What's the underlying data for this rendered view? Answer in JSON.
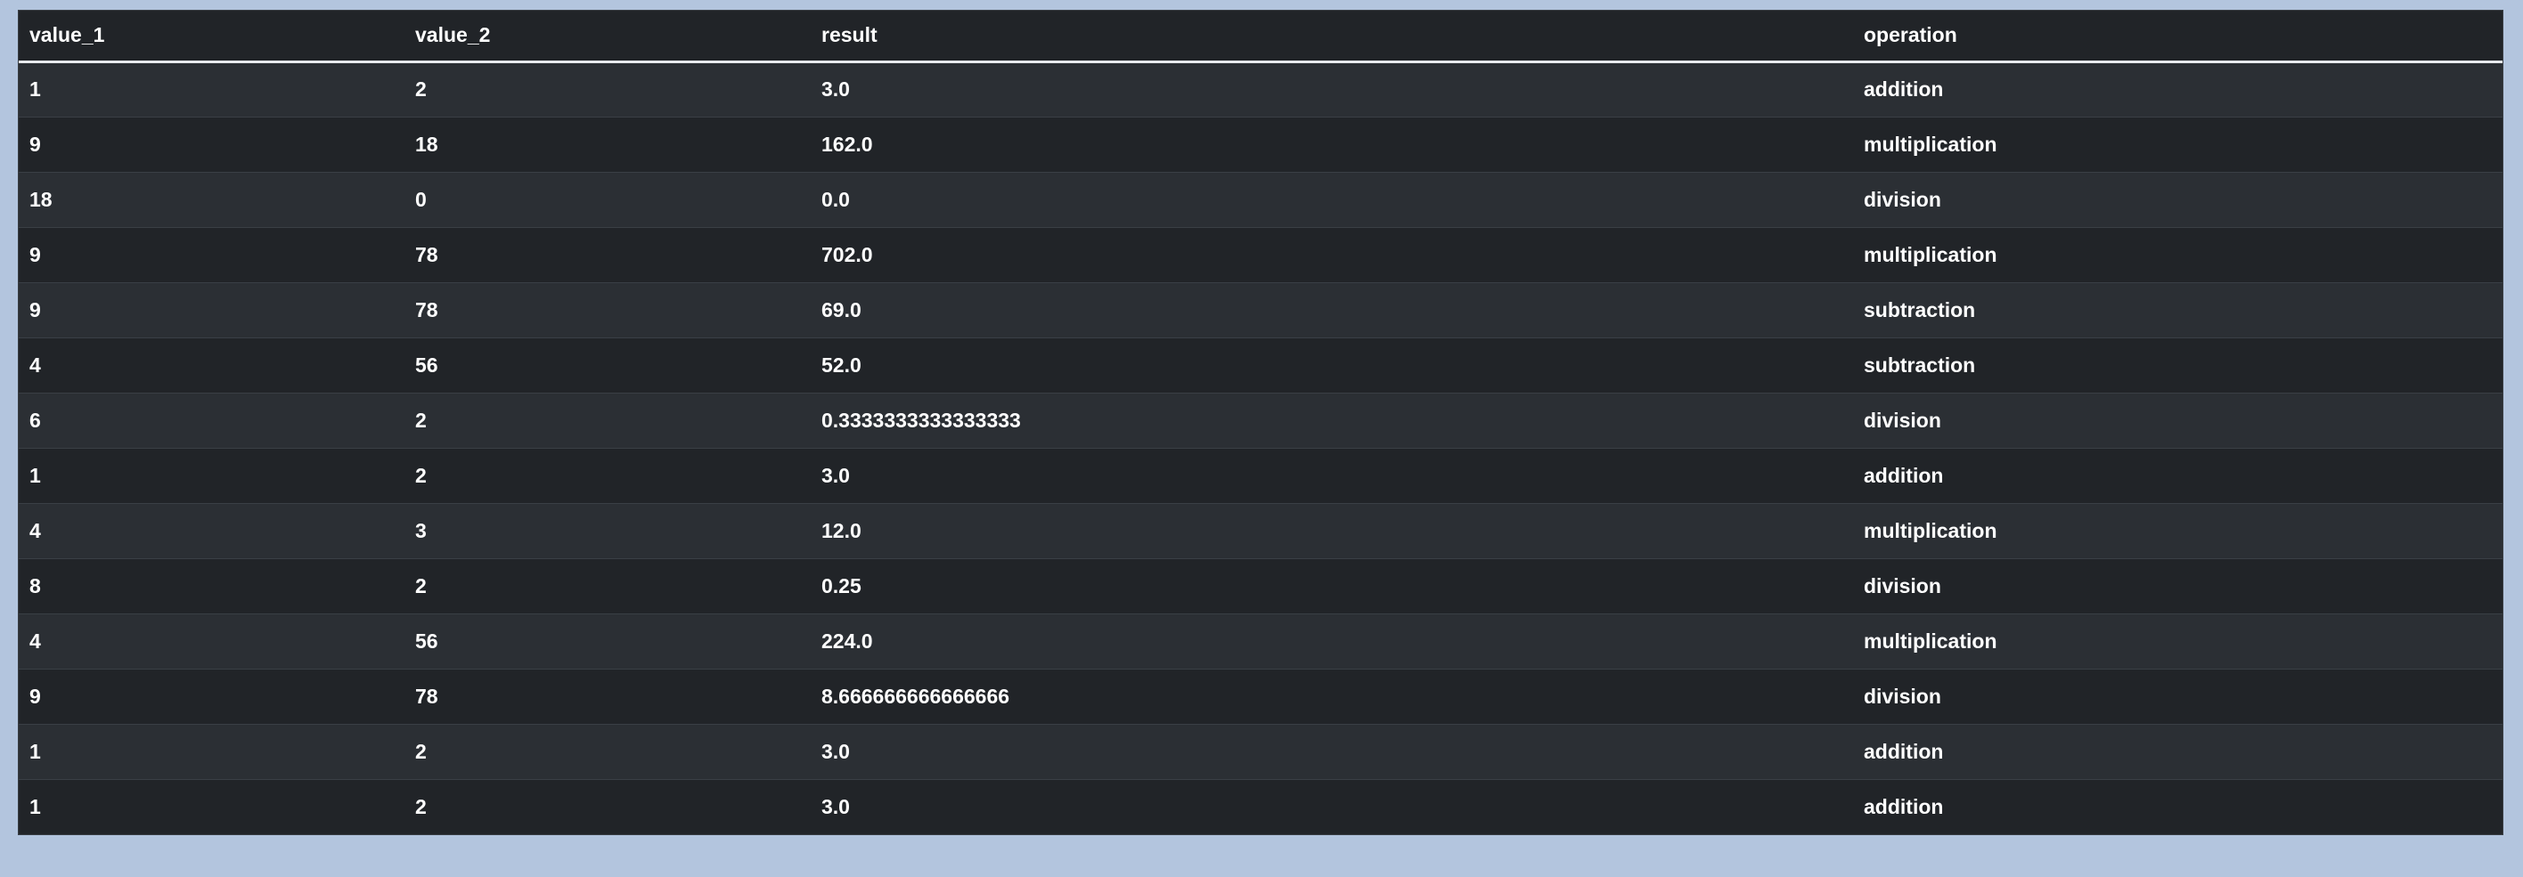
{
  "table": {
    "columns": [
      "value_1",
      "value_2",
      "result",
      "operation"
    ],
    "rows": [
      [
        "1",
        "2",
        "3.0",
        "addition"
      ],
      [
        "9",
        "18",
        "162.0",
        "multiplication"
      ],
      [
        "18",
        "0",
        "0.0",
        "division"
      ],
      [
        "9",
        "78",
        "702.0",
        "multiplication"
      ],
      [
        "9",
        "78",
        "69.0",
        "subtraction"
      ],
      [
        "4",
        "56",
        "52.0",
        "subtraction"
      ],
      [
        "6",
        "2",
        "0.3333333333333333",
        "division"
      ],
      [
        "1",
        "2",
        "3.0",
        "addition"
      ],
      [
        "4",
        "3",
        "12.0",
        "multiplication"
      ],
      [
        "8",
        "2",
        "0.25",
        "division"
      ],
      [
        "4",
        "56",
        "224.0",
        "multiplication"
      ],
      [
        "9",
        "78",
        "8.666666666666666",
        "division"
      ],
      [
        "1",
        "2",
        "3.0",
        "addition"
      ],
      [
        "1",
        "2",
        "3.0",
        "addition"
      ]
    ]
  },
  "colors": {
    "page_background": "#b3c5de",
    "table_background": "#212428",
    "row_stripe": "#2b2f34",
    "text": "#ffffff"
  }
}
